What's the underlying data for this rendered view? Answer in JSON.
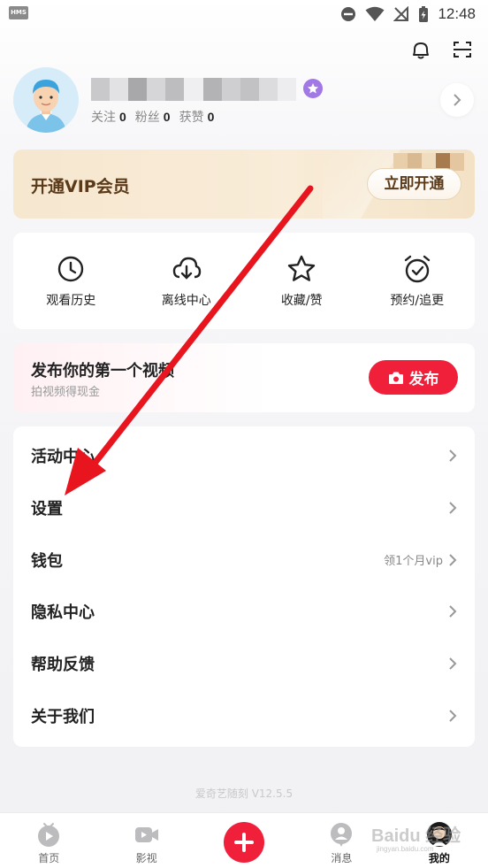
{
  "status_bar": {
    "badge": "HMS",
    "time": "12:48",
    "icons": [
      "do-not-disturb-icon",
      "wifi-icon",
      "no-signal-icon",
      "battery-charging-icon"
    ]
  },
  "header": {
    "icons": [
      "bell-icon",
      "scan-icon"
    ]
  },
  "profile": {
    "avatar": "avatar-illustration",
    "badge_icon": "vip-star-icon",
    "stats": [
      {
        "label": "关注",
        "value": "0"
      },
      {
        "label": "粉丝",
        "value": "0"
      },
      {
        "label": "获赞",
        "value": "0"
      }
    ]
  },
  "vip": {
    "title": "开通VIP会员",
    "button": "立即开通"
  },
  "quick_actions": [
    {
      "label": "观看历史",
      "icon": "clock-icon"
    },
    {
      "label": "离线中心",
      "icon": "download-cloud-icon"
    },
    {
      "label": "收藏/赞",
      "icon": "star-icon"
    },
    {
      "label": "预约/追更",
      "icon": "alarm-check-icon"
    }
  ],
  "publish": {
    "title": "发布你的第一个视频",
    "subtitle": "拍视频得现金",
    "button": "发布",
    "button_icon": "camera-icon"
  },
  "menu": [
    {
      "label": "活动中心",
      "hint": ""
    },
    {
      "label": "设置",
      "hint": ""
    },
    {
      "label": "钱包",
      "hint": "领1个月vip"
    },
    {
      "label": "隐私中心",
      "hint": ""
    },
    {
      "label": "帮助反馈",
      "hint": ""
    },
    {
      "label": "关于我们",
      "hint": ""
    }
  ],
  "version": "爱奇艺随刻 V12.5.5",
  "bottom_nav": [
    {
      "label": "首页",
      "icon": "home-tv-icon",
      "active": false
    },
    {
      "label": "影视",
      "icon": "video-camera-icon",
      "active": false
    },
    {
      "label": "",
      "icon": "plus-icon",
      "active": false
    },
    {
      "label": "消息",
      "icon": "message-person-icon",
      "active": false
    },
    {
      "label": "我的",
      "icon": "profile-avatar-icon",
      "active": true
    }
  ],
  "watermark": {
    "text": "Baidu 经验",
    "sub": "jingyan.baidu.com"
  },
  "colors": {
    "accent_red": "#f0203b",
    "vip_brown": "#5b3a1a",
    "annotation_red": "#e8141e"
  }
}
